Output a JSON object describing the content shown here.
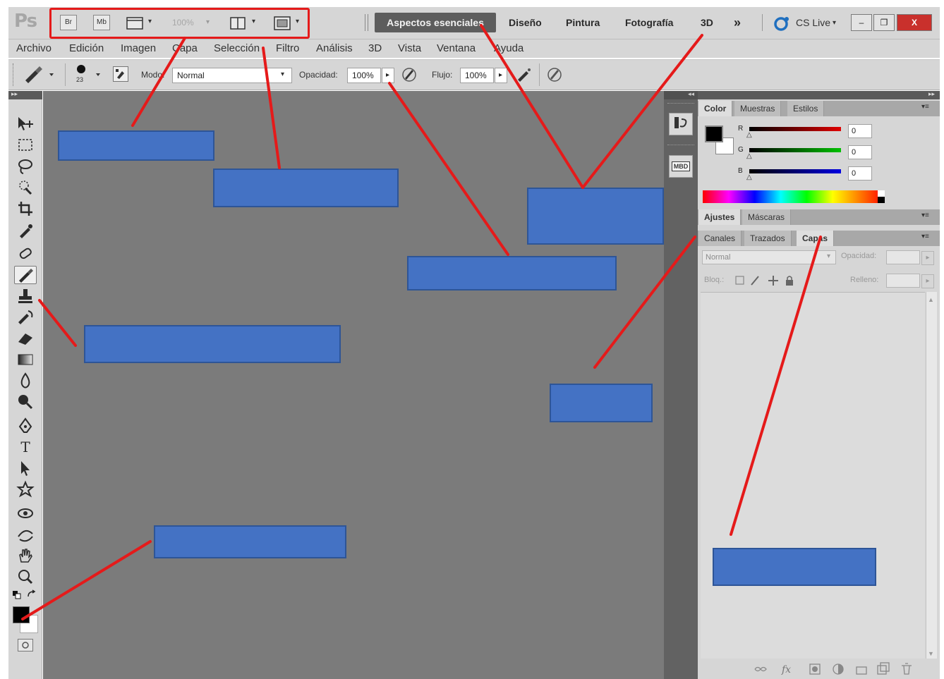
{
  "app": {
    "logo_text": "Ps"
  },
  "appbar": {
    "bridge_label": "Br",
    "minibridge_label": "Mb",
    "zoom_value": "100%",
    "caret": "▾",
    "workspaces": [
      "Aspectos esenciales",
      "Diseño",
      "Pintura",
      "Fotografía",
      "3D"
    ],
    "overflow": "»",
    "cslive_label": "CS Live",
    "minimize": "–",
    "restore": "❐",
    "close": "X"
  },
  "menu": [
    "Archivo",
    "Edición",
    "Imagen",
    "Capa",
    "Selección",
    "Filtro",
    "Análisis",
    "3D",
    "Vista",
    "Ventana",
    "Ayuda"
  ],
  "options": {
    "brush_size": "23",
    "mode_label": "Modo:",
    "mode_value": "Normal",
    "opacity_label": "Opacidad:",
    "opacity_value": "100%",
    "flow_label": "Flujo:",
    "flow_value": "100%",
    "arrow": "▸"
  },
  "color_panel": {
    "tabs": [
      "Color",
      "Muestras",
      "Estilos"
    ],
    "channels": [
      {
        "label": "R",
        "value": "0"
      },
      {
        "label": "G",
        "value": "0"
      },
      {
        "label": "B",
        "value": "0"
      }
    ]
  },
  "adjust_panel": {
    "tabs": [
      "Ajustes",
      "Máscaras"
    ]
  },
  "layers_panel": {
    "tabs": [
      "Canales",
      "Trazados",
      "Capas"
    ],
    "blend_mode": "Normal",
    "opacity_label": "Opacidad:",
    "lock_label": "Bloq.:",
    "fill_label": "Relleno:"
  },
  "dock": {
    "mini_label": "MBD"
  },
  "panel_menu": "▾≡",
  "icons": {
    "move": "move-icon",
    "marquee": "marquee-icon",
    "lasso": "lasso-icon",
    "quick-select": "quick-select-icon",
    "crop": "crop-icon",
    "eyedropper": "eyedropper-icon",
    "healing": "healing-brush-icon",
    "brush": "brush-icon",
    "stamp": "clone-stamp-icon",
    "history-brush": "history-brush-icon",
    "eraser": "eraser-icon",
    "gradient": "gradient-icon",
    "blur": "blur-icon",
    "dodge": "dodge-icon",
    "pen": "pen-icon",
    "type": "type-icon",
    "path-select": "path-selection-icon",
    "shape": "shape-icon",
    "rotate-3d": "3d-rotate-icon",
    "orbit-3d": "3d-orbit-icon",
    "hand": "hand-icon",
    "zoom": "zoom-icon"
  },
  "colors": {
    "callout_fill": "#4472c4",
    "pointer_red": "#e51a1a",
    "canvas_gray": "#7b7b7b",
    "panel_gray": "#d6d6d6"
  }
}
